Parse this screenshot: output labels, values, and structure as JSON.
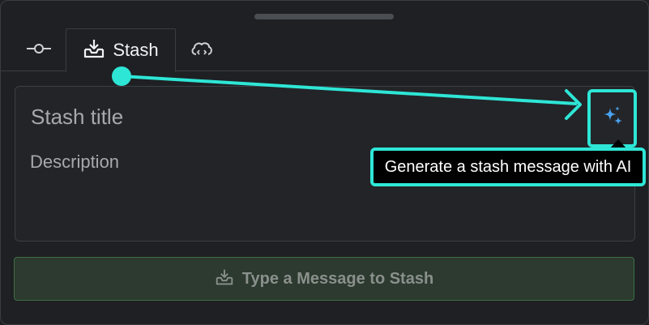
{
  "tabs": [
    {
      "name": "commit",
      "label": "",
      "icon": "commit-node-icon"
    },
    {
      "name": "stash",
      "label": "Stash",
      "icon": "stash-tray-icon",
      "active": true
    },
    {
      "name": "cloud-patch",
      "label": "",
      "icon": "cloud-code-icon"
    }
  ],
  "form": {
    "title_placeholder": "Stash title",
    "description_placeholder": "Description"
  },
  "ai_button": {
    "icon": "sparkle-icon",
    "tooltip": "Generate a stash message with AI"
  },
  "stash_button": {
    "label": "Type a Message to Stash",
    "icon": "stash-tray-icon"
  },
  "colors": {
    "highlight": "#2ee6d6",
    "background": "#1e2024",
    "sparkle": "#4aa3f0",
    "button_fill": "#2c3a2f",
    "button_border": "#3f7043"
  }
}
